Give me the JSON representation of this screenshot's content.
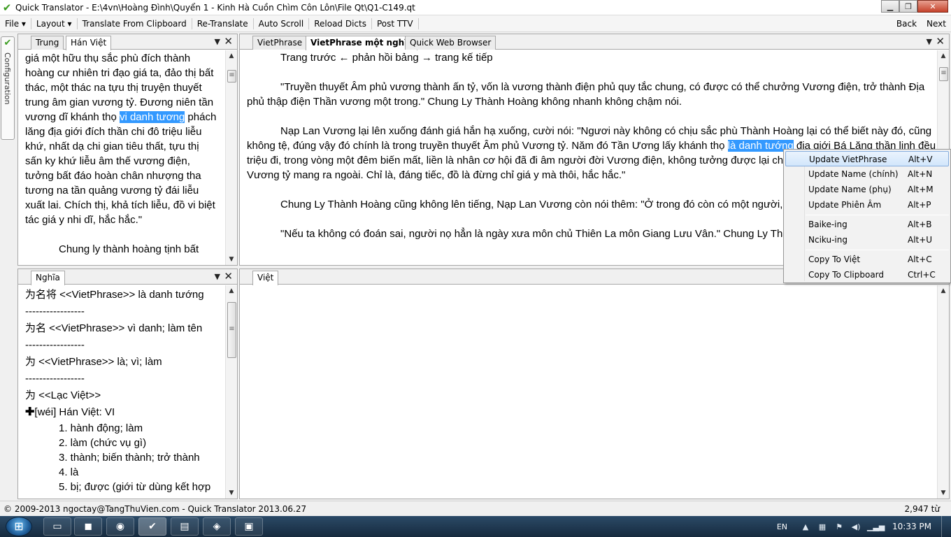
{
  "window": {
    "title": "Quick Translator - E:\\4vn\\Hoàng Đình\\Quyển 1 - Kinh Hà Cuồn Chìm Côn Lôn\\File Qt\\Q1-C149.qt",
    "minimize": "▁",
    "maximize": "❐",
    "close": "✕"
  },
  "menubar": {
    "file": "File ▾",
    "layout": "Layout ▾",
    "translate_clipboard": "Translate From Clipboard",
    "retranslate": "Re-Translate",
    "auto_scroll": "Auto Scroll",
    "reload_dicts": "Reload Dicts",
    "post_ttv": "Post TTV",
    "back": "Back",
    "next": "Next"
  },
  "sidebar": {
    "configuration": "Configuration"
  },
  "source_panel": {
    "tabs": [
      "Trung",
      "Hán Việt"
    ],
    "lines": [
      "giá một hữu thụ sắc phù đích thành",
      "hoàng cư nhiên tri đạo giá ta, đảo thị bất",
      "thác, một thác na tựu thị truyện thuyết",
      "trung âm gian vương tỷ. Đương niên tần",
      "lăng địa giới đích thần chi đô triệu liễu",
      "khứ, nhất dạ chi gian tiêu thất, tựu thị",
      "sấn ky khứ liễu âm thế vương điện,",
      "tưởng bất đáo hoàn chân nhượng tha",
      "tương na tần quảng vương tỷ đái liễu",
      "xuất lai. Chích thị, khả tích liễu, đồ vi biệt",
      "tác giá y nhi dĩ, hắc hắc.\""
    ],
    "line5_pre": "vương dĩ khánh thọ ",
    "line5_hl": "vi danh tương",
    "line5_post": " phách",
    "para2": "Chung ly thành hoàng tịnh bất"
  },
  "vp_panel": {
    "tabs": [
      "VietPhrase",
      "VietPhrase một nghĩa",
      "Quick Web Browser"
    ],
    "p1": "Trang trước ← phản hồi bảng → trang kế tiếp",
    "p2": "\"Truyền thuyết Âm phủ vương thành ấn tỷ, vốn là vương thành điện phủ quy tắc chung, có được có thể chưởng Vương điện, trở thành Địa phủ thập điện Thần vương một trong.\" Chung Ly Thành Hoàng không nhanh không chậm nói.",
    "p3_pre": "Nạp Lan Vương lại lên xuống đánh giá hắn hạ xuống, cười nói: \"Ngươi này không có chịu sắc phù Thành Hoàng lại có thể biết này đó, cũng không tệ, đúng vậy đó chính là trong truyền thuyết Âm phủ Vương tỷ. Năm đó Tần Ương lấy khánh thọ ",
    "p3_hl": "là danh tướng",
    "p3_post": " địa giới Bá Lăng thần linh đều triệu đi, trong vòng một đêm biến mất, liền là nhân cơ hội đã đi âm người đời Vương điện, không tưởng được lại cho hắn đem kia Tần Quảng Vương tỷ mang ra ngoài. Chỉ là, đáng tiếc, đồ là đừng chỉ giá y mà thôi, hắc hắc.\"",
    "p4": "Chung Ly Thành Hoàng cũng không lên tiếng, Nạp Lan Vương còn nói thêm: \"Ở trong đó còn có một người, các ngươi đoán xem là ai \"",
    "p5": "\"Nếu ta không có đoán sai, người nọ hẳn là ngày xưa môn chủ Thiên La môn Giang Lưu Vân.\" Chung Ly Thành Hoàng nói."
  },
  "nghia_panel": {
    "tab": "Nghĩa",
    "e1": "为名将 <<VietPhrase>> là danh tướng",
    "dash": "-----------------",
    "e2": "为名 <<VietPhrase>> vì danh; làm tên",
    "e3": "为 <<VietPhrase>> là; vì; làm",
    "e4": "为 <<Lạc Việt>>",
    "plus": "✚",
    "e5": "[wéi] Hán Việt: VI",
    "defs": [
      "1. hành động; làm",
      "2. làm (chức vụ gì)",
      "3. thành; biến thành; trở thành",
      "4. là",
      "5. bị; được (giới từ dùng kết hợp"
    ]
  },
  "viet_panel": {
    "tab": "Việt"
  },
  "context_menu": {
    "items": [
      {
        "label": "Update VietPhrase",
        "key": "Alt+V"
      },
      {
        "label": "Update Name (chính)",
        "key": "Alt+N"
      },
      {
        "label": "Update Name (phụ)",
        "key": "Alt+M"
      },
      {
        "label": "Update Phiên Âm",
        "key": "Alt+P"
      },
      {
        "label": "Baike-ing",
        "key": "Alt+B"
      },
      {
        "label": "Nciku-ing",
        "key": "Alt+U"
      },
      {
        "label": "Copy To Việt",
        "key": "Alt+C"
      },
      {
        "label": "Copy To Clipboard",
        "key": "Ctrl+C"
      }
    ]
  },
  "statusbar": {
    "left": "© 2009-2013 ngoctay@TangThuVien.com - Quick Translator 2013.06.27",
    "right": "2,947 từ"
  },
  "taskbar": {
    "lang": "EN",
    "time": "10:33 PM"
  }
}
